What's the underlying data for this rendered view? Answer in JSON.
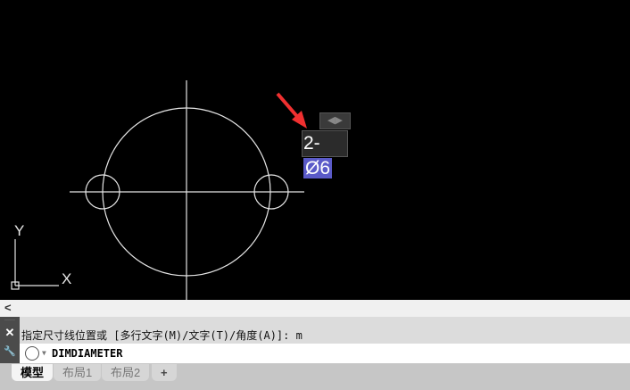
{
  "drawing": {
    "dimension_text_prefix": "2-",
    "dimension_text_selected": "Ø6",
    "ucs_x": "X",
    "ucs_y": "Y",
    "arrows_glyph": "◀▶"
  },
  "command": {
    "scroll_left": "<",
    "history": "指定尺寸线位置或 [多行文字(M)/文字(T)/角度(A)]: m",
    "input": "DIMDIAMETER",
    "close": "✕",
    "settings": "🔧"
  },
  "tabs": [
    {
      "label": "模型"
    },
    {
      "label": "布局1"
    },
    {
      "label": "布局2"
    },
    {
      "label": "+"
    }
  ]
}
